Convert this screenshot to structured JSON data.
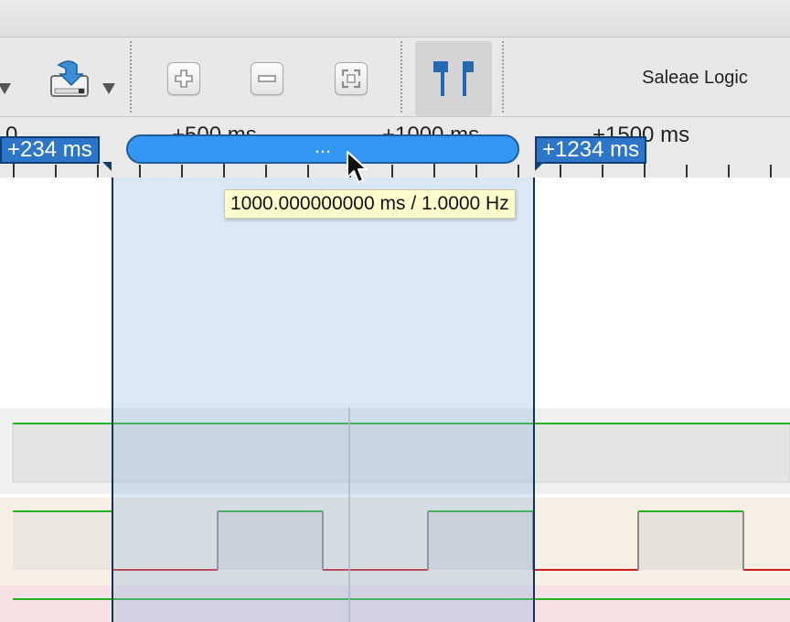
{
  "app": {
    "title": "Saleae Logic"
  },
  "toolbar": {
    "icons": {
      "download": "download-capture-icon",
      "zoom_in": "zoom-in-icon",
      "zoom_out": "zoom-out-icon",
      "zoom_fit": "zoom-fit-icon",
      "markers": "timing-markers-icon"
    }
  },
  "ruler": {
    "labels": [
      "0",
      "+500 ms",
      "+1000 ms",
      "+1500 ms"
    ]
  },
  "timing_markers": {
    "left_label": "+234 ms",
    "right_label": "+1234 ms",
    "bar_label": "..."
  },
  "tooltip": {
    "text": "1000.000000000 ms / 1.0000 Hz"
  },
  "colors": {
    "marker_blue": "#2d75c9",
    "bar_blue": "#3497f3",
    "signal_high": "#22b322",
    "signal_low": "#cc1f1f",
    "tooltip_bg": "#ffffce",
    "selection": "#c4d9ee"
  },
  "channels": [
    {
      "name": "",
      "level": "high"
    },
    {
      "name": "",
      "pattern": "clock"
    },
    {
      "name": "",
      "level": "high"
    }
  ]
}
